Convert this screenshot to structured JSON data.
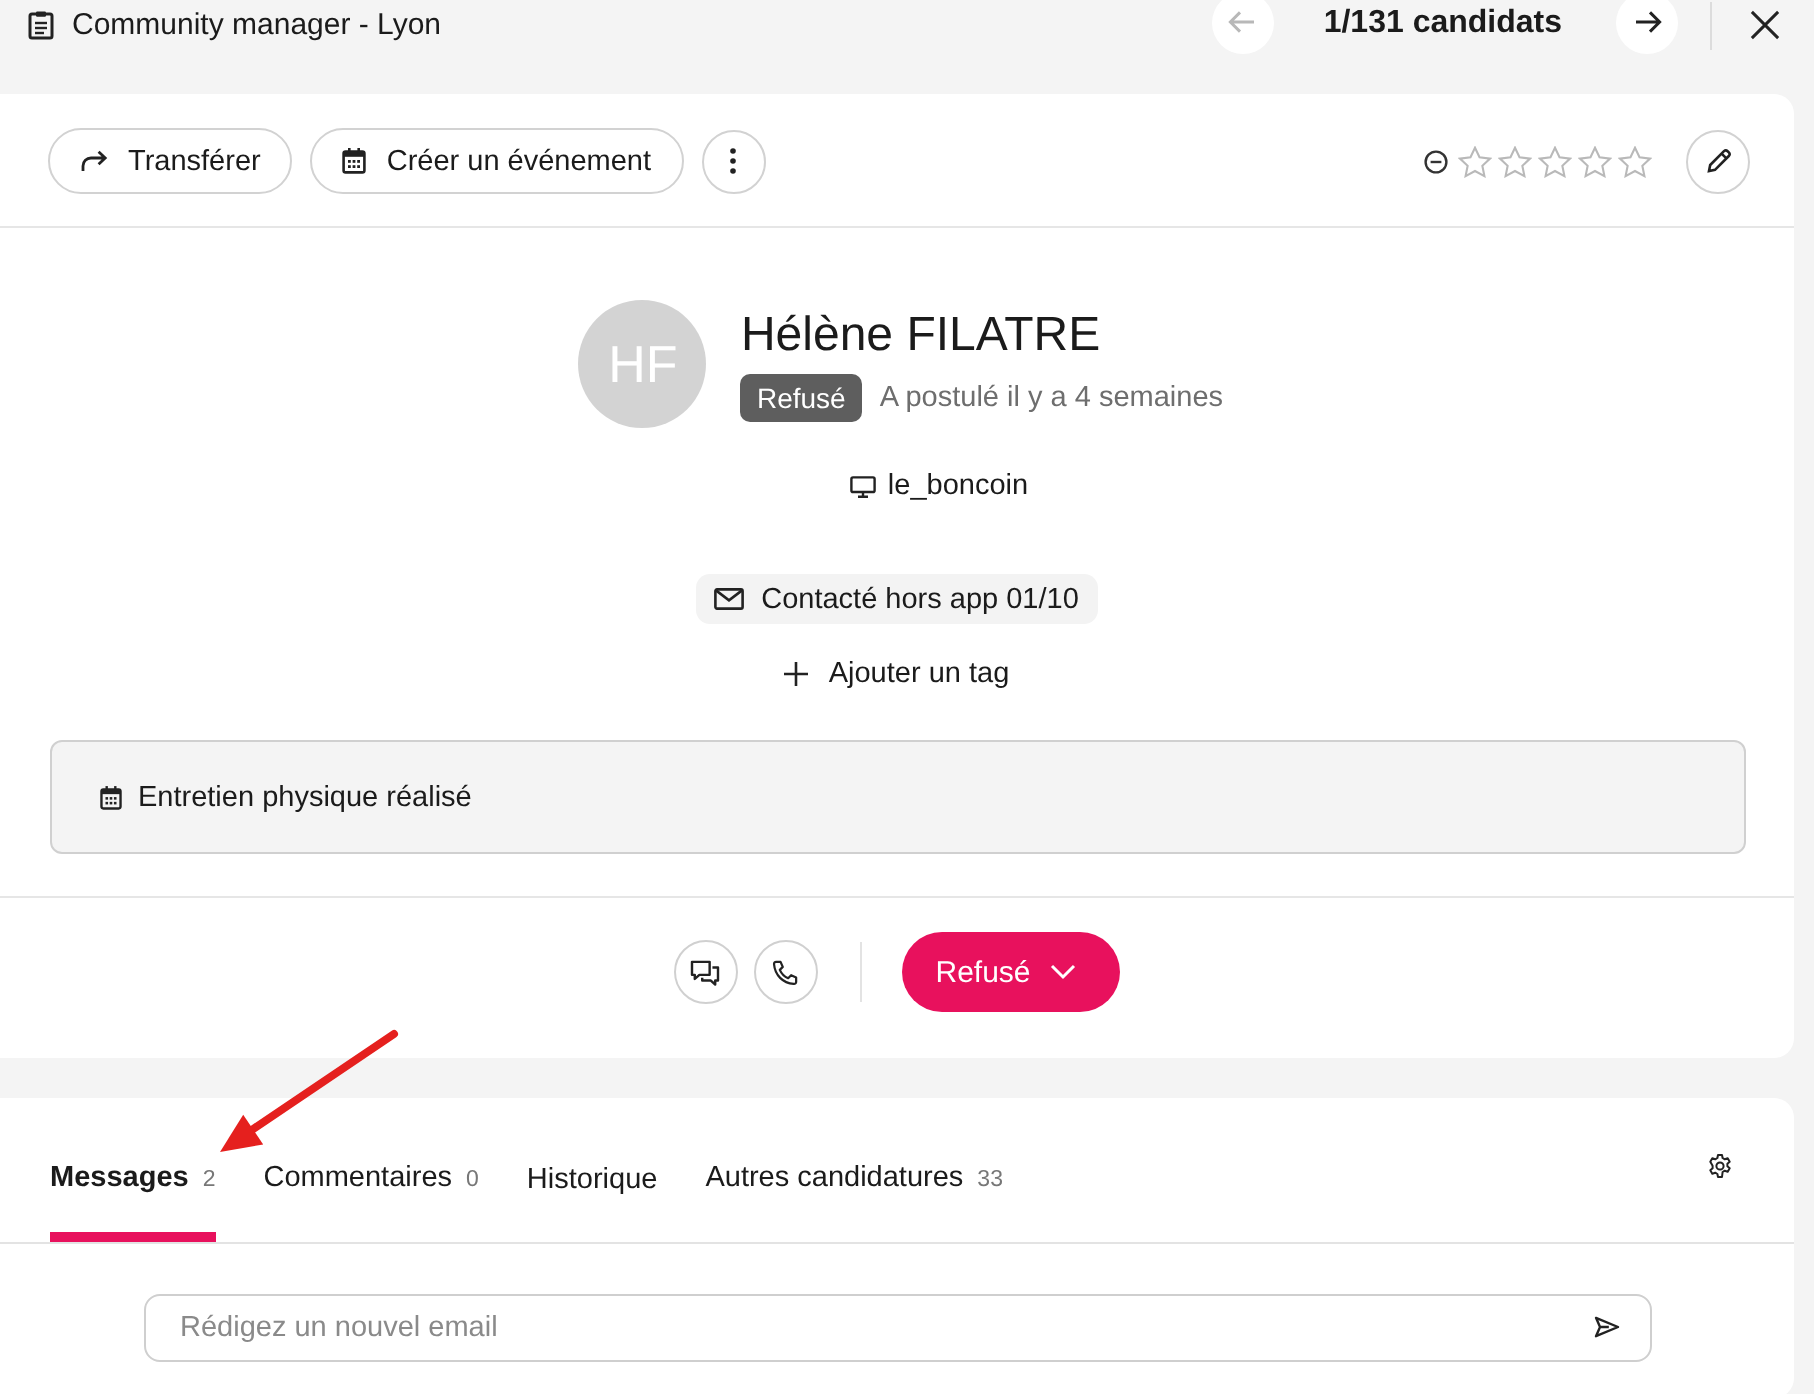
{
  "header": {
    "title": "Community manager - Lyon",
    "previous": {
      "disabled": true
    },
    "counter": "1/131 candidats",
    "next": {
      "disabled": false
    }
  },
  "toolbar": {
    "buttons": [
      {
        "kind": "transfer",
        "label": "Transférer"
      },
      {
        "kind": "event",
        "label": "Créer un événement"
      },
      {
        "kind": "more"
      }
    ],
    "rating": {
      "stars": 0
    }
  },
  "candidate": {
    "initials": "HF",
    "name": "Hélène FILATRE",
    "status_badge": "Refusé",
    "applied": "A postulé il y a 4 semaines",
    "source": "le_boncoin",
    "contact_chip": "Contacté hors app 01/10",
    "add_tag": "Ajouter un tag"
  },
  "note": {
    "text": "Entretien physique réalisé"
  },
  "actions": {
    "status_button": "Refusé"
  },
  "tabs": [
    {
      "label": "Messages",
      "count": "2",
      "selected": true
    },
    {
      "label": "Commentaires",
      "count": "0",
      "selected": false
    },
    {
      "label": "Historique",
      "selected": false
    },
    {
      "label": "Autres candidatures",
      "count": "33",
      "selected": false
    }
  ],
  "composer": {
    "placeholder": "Rédigez un nouvel email"
  }
}
